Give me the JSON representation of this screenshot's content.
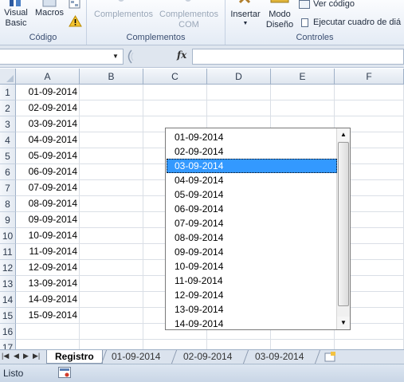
{
  "ribbon": {
    "codigo": {
      "label": "Código",
      "visual_basic": [
        "Visual",
        "Basic"
      ],
      "macros": "Macros"
    },
    "complementos": {
      "label": "Complementos",
      "complementos_btn": "Complementos",
      "complementos_com": [
        "Complementos",
        "COM"
      ]
    },
    "controles": {
      "label": "Controles",
      "insertar": "Insertar",
      "modo_diseno": [
        "Modo",
        "Diseño"
      ],
      "ver_codigo": "Ver código",
      "ejecutar": "Ejecutar cuadro de diá"
    }
  },
  "formula_bar": {
    "name_box": "",
    "fx": "fx",
    "formula": ""
  },
  "grid": {
    "columns": [
      "A",
      "B",
      "C",
      "D",
      "E",
      "F"
    ],
    "rows": [
      "1",
      "2",
      "3",
      "4",
      "5",
      "6",
      "7",
      "8",
      "9",
      "10",
      "11",
      "12",
      "13",
      "14",
      "15",
      "16",
      "17"
    ],
    "column_a_values": [
      "01-09-2014",
      "02-09-2014",
      "03-09-2014",
      "04-09-2014",
      "05-09-2014",
      "06-09-2014",
      "07-09-2014",
      "08-09-2014",
      "09-09-2014",
      "10-09-2014",
      "11-09-2014",
      "12-09-2014",
      "13-09-2014",
      "14-09-2014",
      "15-09-2014"
    ]
  },
  "listbox": {
    "items": [
      "01-09-2014",
      "02-09-2014",
      "03-09-2014",
      "04-09-2014",
      "05-09-2014",
      "06-09-2014",
      "07-09-2014",
      "08-09-2014",
      "09-09-2014",
      "10-09-2014",
      "11-09-2014",
      "12-09-2014",
      "13-09-2014",
      "14-09-2014"
    ],
    "selected_index": 2,
    "selection_color": "#3399ff"
  },
  "sheet_tabs": {
    "tabs": [
      "Registro",
      "01-09-2014",
      "02-09-2014",
      "03-09-2014"
    ],
    "active": "Registro"
  },
  "status_bar": {
    "text": "Listo"
  },
  "colors": {
    "ribbon_bg": "#e4ebf5",
    "header_bg": "#dfe6ef",
    "disabled_text": "#9aa7b8"
  }
}
